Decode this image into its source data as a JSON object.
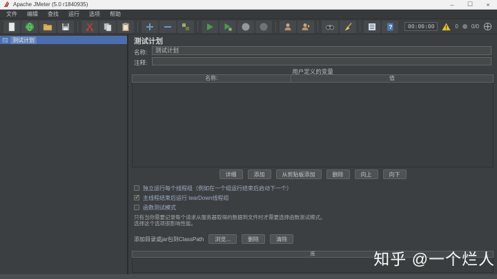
{
  "window": {
    "title": "Apache JMeter (5.0 r1840935)",
    "controls": {
      "minimize": "–",
      "maximize": "☐",
      "close": "×"
    }
  },
  "menu": {
    "items": [
      "文件",
      "编辑",
      "查找",
      "运行",
      "选项",
      "帮助"
    ]
  },
  "toolbar": {
    "icons": [
      "new-file-icon",
      "templates-icon",
      "open-file-icon",
      "save-icon",
      "cut-icon",
      "copy-icon",
      "paste-icon",
      "add-icon",
      "remove-icon",
      "toggle-icon",
      "start-icon",
      "start-no-pauses-icon",
      "stop-icon",
      "shutdown-icon",
      "remote-start-icon",
      "remote-start-all-icon",
      "search-icon",
      "clear-icon",
      "view-log-icon",
      "help-icon",
      "warning-icon",
      "status-target-icon"
    ],
    "timer": "00:00:00",
    "warning_count": "0",
    "threads": "0/0"
  },
  "tree": {
    "items": [
      {
        "label": "测试计划",
        "selected": true
      }
    ]
  },
  "main": {
    "title": "测试计划",
    "name_label": "名称:",
    "name_value": "测试计划",
    "comment_label": "注释:",
    "comment_value": "",
    "udv": {
      "title": "用户定义的变量",
      "columns": [
        "名称:",
        "值"
      ],
      "rows": [],
      "buttons": [
        "详细",
        "添加",
        "从剪贴板添加",
        "删除",
        "向上",
        "向下"
      ]
    },
    "checkboxes": [
      {
        "label": "独立运行每个线程组（例如在一个组运行结束后启动下一个）",
        "checked": false
      },
      {
        "label": "主线程结束后运行 tearDown线程组",
        "checked": true
      },
      {
        "label": "函数测试模式",
        "checked": false
      }
    ],
    "help_text": [
      "只有当你需要记录每个请求从服务器取得的数据到文件时才需要选择函数测试模式。",
      "选择这个选项很影响性能。"
    ],
    "classpath": {
      "label": "添加目录或jar包到ClassPath",
      "buttons": [
        "浏览...",
        "删除",
        "清除"
      ]
    },
    "library": {
      "column": "库"
    }
  },
  "watermark": "知乎 @一个烂人",
  "colors": {
    "selection": "#4b6eaf",
    "panel": "#3c3f41",
    "accent_warning": "#e7c32a",
    "start_green": "#4b9b52",
    "cut_red": "#c4403a"
  }
}
